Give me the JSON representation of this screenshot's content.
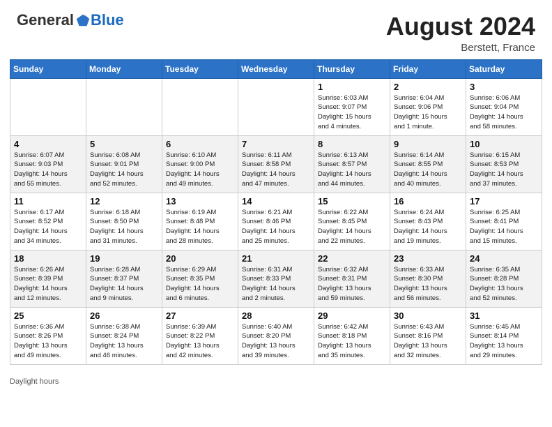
{
  "header": {
    "logo_general": "General",
    "logo_blue": "Blue",
    "month": "August 2024",
    "location": "Berstett, France"
  },
  "days_of_week": [
    "Sunday",
    "Monday",
    "Tuesday",
    "Wednesday",
    "Thursday",
    "Friday",
    "Saturday"
  ],
  "footer": {
    "daylight_label": "Daylight hours"
  },
  "weeks": [
    [
      {
        "num": "",
        "info": ""
      },
      {
        "num": "",
        "info": ""
      },
      {
        "num": "",
        "info": ""
      },
      {
        "num": "",
        "info": ""
      },
      {
        "num": "1",
        "info": "Sunrise: 6:03 AM\nSunset: 9:07 PM\nDaylight: 15 hours\nand 4 minutes."
      },
      {
        "num": "2",
        "info": "Sunrise: 6:04 AM\nSunset: 9:06 PM\nDaylight: 15 hours\nand 1 minute."
      },
      {
        "num": "3",
        "info": "Sunrise: 6:06 AM\nSunset: 9:04 PM\nDaylight: 14 hours\nand 58 minutes."
      }
    ],
    [
      {
        "num": "4",
        "info": "Sunrise: 6:07 AM\nSunset: 9:03 PM\nDaylight: 14 hours\nand 55 minutes."
      },
      {
        "num": "5",
        "info": "Sunrise: 6:08 AM\nSunset: 9:01 PM\nDaylight: 14 hours\nand 52 minutes."
      },
      {
        "num": "6",
        "info": "Sunrise: 6:10 AM\nSunset: 9:00 PM\nDaylight: 14 hours\nand 49 minutes."
      },
      {
        "num": "7",
        "info": "Sunrise: 6:11 AM\nSunset: 8:58 PM\nDaylight: 14 hours\nand 47 minutes."
      },
      {
        "num": "8",
        "info": "Sunrise: 6:13 AM\nSunset: 8:57 PM\nDaylight: 14 hours\nand 44 minutes."
      },
      {
        "num": "9",
        "info": "Sunrise: 6:14 AM\nSunset: 8:55 PM\nDaylight: 14 hours\nand 40 minutes."
      },
      {
        "num": "10",
        "info": "Sunrise: 6:15 AM\nSunset: 8:53 PM\nDaylight: 14 hours\nand 37 minutes."
      }
    ],
    [
      {
        "num": "11",
        "info": "Sunrise: 6:17 AM\nSunset: 8:52 PM\nDaylight: 14 hours\nand 34 minutes."
      },
      {
        "num": "12",
        "info": "Sunrise: 6:18 AM\nSunset: 8:50 PM\nDaylight: 14 hours\nand 31 minutes."
      },
      {
        "num": "13",
        "info": "Sunrise: 6:19 AM\nSunset: 8:48 PM\nDaylight: 14 hours\nand 28 minutes."
      },
      {
        "num": "14",
        "info": "Sunrise: 6:21 AM\nSunset: 8:46 PM\nDaylight: 14 hours\nand 25 minutes."
      },
      {
        "num": "15",
        "info": "Sunrise: 6:22 AM\nSunset: 8:45 PM\nDaylight: 14 hours\nand 22 minutes."
      },
      {
        "num": "16",
        "info": "Sunrise: 6:24 AM\nSunset: 8:43 PM\nDaylight: 14 hours\nand 19 minutes."
      },
      {
        "num": "17",
        "info": "Sunrise: 6:25 AM\nSunset: 8:41 PM\nDaylight: 14 hours\nand 15 minutes."
      }
    ],
    [
      {
        "num": "18",
        "info": "Sunrise: 6:26 AM\nSunset: 8:39 PM\nDaylight: 14 hours\nand 12 minutes."
      },
      {
        "num": "19",
        "info": "Sunrise: 6:28 AM\nSunset: 8:37 PM\nDaylight: 14 hours\nand 9 minutes."
      },
      {
        "num": "20",
        "info": "Sunrise: 6:29 AM\nSunset: 8:35 PM\nDaylight: 14 hours\nand 6 minutes."
      },
      {
        "num": "21",
        "info": "Sunrise: 6:31 AM\nSunset: 8:33 PM\nDaylight: 14 hours\nand 2 minutes."
      },
      {
        "num": "22",
        "info": "Sunrise: 6:32 AM\nSunset: 8:31 PM\nDaylight: 13 hours\nand 59 minutes."
      },
      {
        "num": "23",
        "info": "Sunrise: 6:33 AM\nSunset: 8:30 PM\nDaylight: 13 hours\nand 56 minutes."
      },
      {
        "num": "24",
        "info": "Sunrise: 6:35 AM\nSunset: 8:28 PM\nDaylight: 13 hours\nand 52 minutes."
      }
    ],
    [
      {
        "num": "25",
        "info": "Sunrise: 6:36 AM\nSunset: 8:26 PM\nDaylight: 13 hours\nand 49 minutes."
      },
      {
        "num": "26",
        "info": "Sunrise: 6:38 AM\nSunset: 8:24 PM\nDaylight: 13 hours\nand 46 minutes."
      },
      {
        "num": "27",
        "info": "Sunrise: 6:39 AM\nSunset: 8:22 PM\nDaylight: 13 hours\nand 42 minutes."
      },
      {
        "num": "28",
        "info": "Sunrise: 6:40 AM\nSunset: 8:20 PM\nDaylight: 13 hours\nand 39 minutes."
      },
      {
        "num": "29",
        "info": "Sunrise: 6:42 AM\nSunset: 8:18 PM\nDaylight: 13 hours\nand 35 minutes."
      },
      {
        "num": "30",
        "info": "Sunrise: 6:43 AM\nSunset: 8:16 PM\nDaylight: 13 hours\nand 32 minutes."
      },
      {
        "num": "31",
        "info": "Sunrise: 6:45 AM\nSunset: 8:14 PM\nDaylight: 13 hours\nand 29 minutes."
      }
    ]
  ]
}
